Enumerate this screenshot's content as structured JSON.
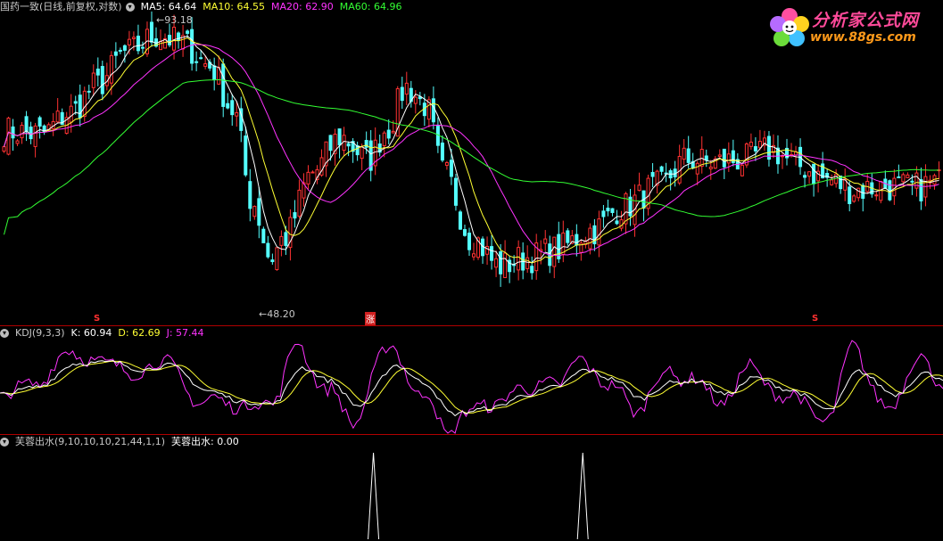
{
  "main_panel": {
    "title": "国药一致(日线,前复权,对数)",
    "indicators": [
      {
        "label": "MA5: 64.64",
        "color": "#ffffff"
      },
      {
        "label": "MA10: 64.55",
        "color": "#ffff33"
      },
      {
        "label": "MA20: 62.90",
        "color": "#ff33ff"
      },
      {
        "label": "MA60: 64.96",
        "color": "#33ff33"
      }
    ],
    "max_label": "93.18",
    "min_label": "48.20",
    "signal_marks": [
      {
        "label": "S",
        "color": "#ff3030"
      },
      {
        "label": "涨",
        "color": "#ff3030"
      },
      {
        "label": "S",
        "color": "#ff3030"
      }
    ]
  },
  "kdj_panel": {
    "title": "KDJ(9,3,3)",
    "indicators": [
      {
        "label": "K: 60.94",
        "color": "#ffffff"
      },
      {
        "label": "D: 62.69",
        "color": "#ffff33"
      },
      {
        "label": "J: 57.44",
        "color": "#ff33ff"
      }
    ]
  },
  "signal_panel": {
    "title": "芙蓉出水(9,10,10,10,21,44,1,1)",
    "indicators": [
      {
        "label": "芙蓉出水: 0.00",
        "color": "#ffffff"
      }
    ]
  },
  "logo": {
    "title": "分析家公式网",
    "url": "www.88gs.com"
  },
  "colors": {
    "up": "#ff3232",
    "down": "#54ffff",
    "ma5": "#ffffff",
    "ma10": "#ffff33",
    "ma20": "#ff33ff",
    "ma60": "#33ff33",
    "separator": "#b00000",
    "background": "#000000"
  },
  "chart_data": [
    {
      "type": "candlestick",
      "title": "国药一致(日线,前复权,对数)",
      "log_scale": true,
      "ylim": [
        48.2,
        93.18
      ],
      "annotations": [
        {
          "label": "93.18",
          "type": "max"
        },
        {
          "label": "48.20",
          "type": "min"
        }
      ],
      "series": [
        {
          "name": "MA5",
          "last": 64.64
        },
        {
          "name": "MA10",
          "last": 64.55
        },
        {
          "name": "MA20",
          "last": 62.9
        },
        {
          "name": "MA60",
          "last": 64.96
        }
      ],
      "close_path_anchors": [
        [
          0,
          72.5
        ],
        [
          0.04,
          72.0
        ],
        [
          0.07,
          75.5
        ],
        [
          0.1,
          80.5
        ],
        [
          0.13,
          86.5
        ],
        [
          0.165,
          90.0
        ],
        [
          0.19,
          88.5
        ],
        [
          0.22,
          84.0
        ],
        [
          0.245,
          76.0
        ],
        [
          0.265,
          62.0
        ],
        [
          0.285,
          54.5
        ],
        [
          0.3,
          57.0
        ],
        [
          0.33,
          66.0
        ],
        [
          0.36,
          71.5
        ],
        [
          0.39,
          68.0
        ],
        [
          0.41,
          73.0
        ],
        [
          0.43,
          80.0
        ],
        [
          0.45,
          77.0
        ],
        [
          0.47,
          66.0
        ],
        [
          0.5,
          57.0
        ],
        [
          0.53,
          53.5
        ],
        [
          0.56,
          54.5
        ],
        [
          0.59,
          55.5
        ],
        [
          0.63,
          58.0
        ],
        [
          0.66,
          61.0
        ],
        [
          0.7,
          64.0
        ],
        [
          0.73,
          68.0
        ],
        [
          0.76,
          67.5
        ],
        [
          0.79,
          68.0
        ],
        [
          0.82,
          69.5
        ],
        [
          0.85,
          67.0
        ],
        [
          0.88,
          65.0
        ],
        [
          0.91,
          63.5
        ],
        [
          0.94,
          64.0
        ],
        [
          0.97,
          63.8
        ],
        [
          1.0,
          64.6
        ]
      ]
    },
    {
      "type": "line",
      "title": "KDJ(9,3,3)",
      "ylim": [
        -10,
        110
      ],
      "series": [
        {
          "name": "K",
          "last": 60.94
        },
        {
          "name": "D",
          "last": 62.69
        },
        {
          "name": "J",
          "last": 57.44
        }
      ],
      "k_anchors": [
        [
          0,
          40
        ],
        [
          0.04,
          50
        ],
        [
          0.08,
          80
        ],
        [
          0.12,
          82
        ],
        [
          0.15,
          72
        ],
        [
          0.18,
          78
        ],
        [
          0.22,
          45
        ],
        [
          0.26,
          30
        ],
        [
          0.29,
          28
        ],
        [
          0.32,
          75
        ],
        [
          0.35,
          58
        ],
        [
          0.38,
          25
        ],
        [
          0.42,
          78
        ],
        [
          0.45,
          55
        ],
        [
          0.48,
          15
        ],
        [
          0.52,
          22
        ],
        [
          0.56,
          40
        ],
        [
          0.59,
          50
        ],
        [
          0.62,
          72
        ],
        [
          0.65,
          60
        ],
        [
          0.68,
          35
        ],
        [
          0.71,
          55
        ],
        [
          0.74,
          58
        ],
        [
          0.77,
          40
        ],
        [
          0.8,
          62
        ],
        [
          0.84,
          45
        ],
        [
          0.88,
          20
        ],
        [
          0.91,
          70
        ],
        [
          0.95,
          40
        ],
        [
          0.98,
          68
        ],
        [
          1.0,
          61
        ]
      ]
    },
    {
      "type": "line",
      "title": "芙蓉出水(9,10,10,10,21,44,1,1)",
      "ylim": [
        0,
        1
      ],
      "series": [
        {
          "name": "芙蓉出水",
          "last": 0.0
        }
      ],
      "spikes_at": [
        0.396,
        0.618
      ]
    }
  ]
}
